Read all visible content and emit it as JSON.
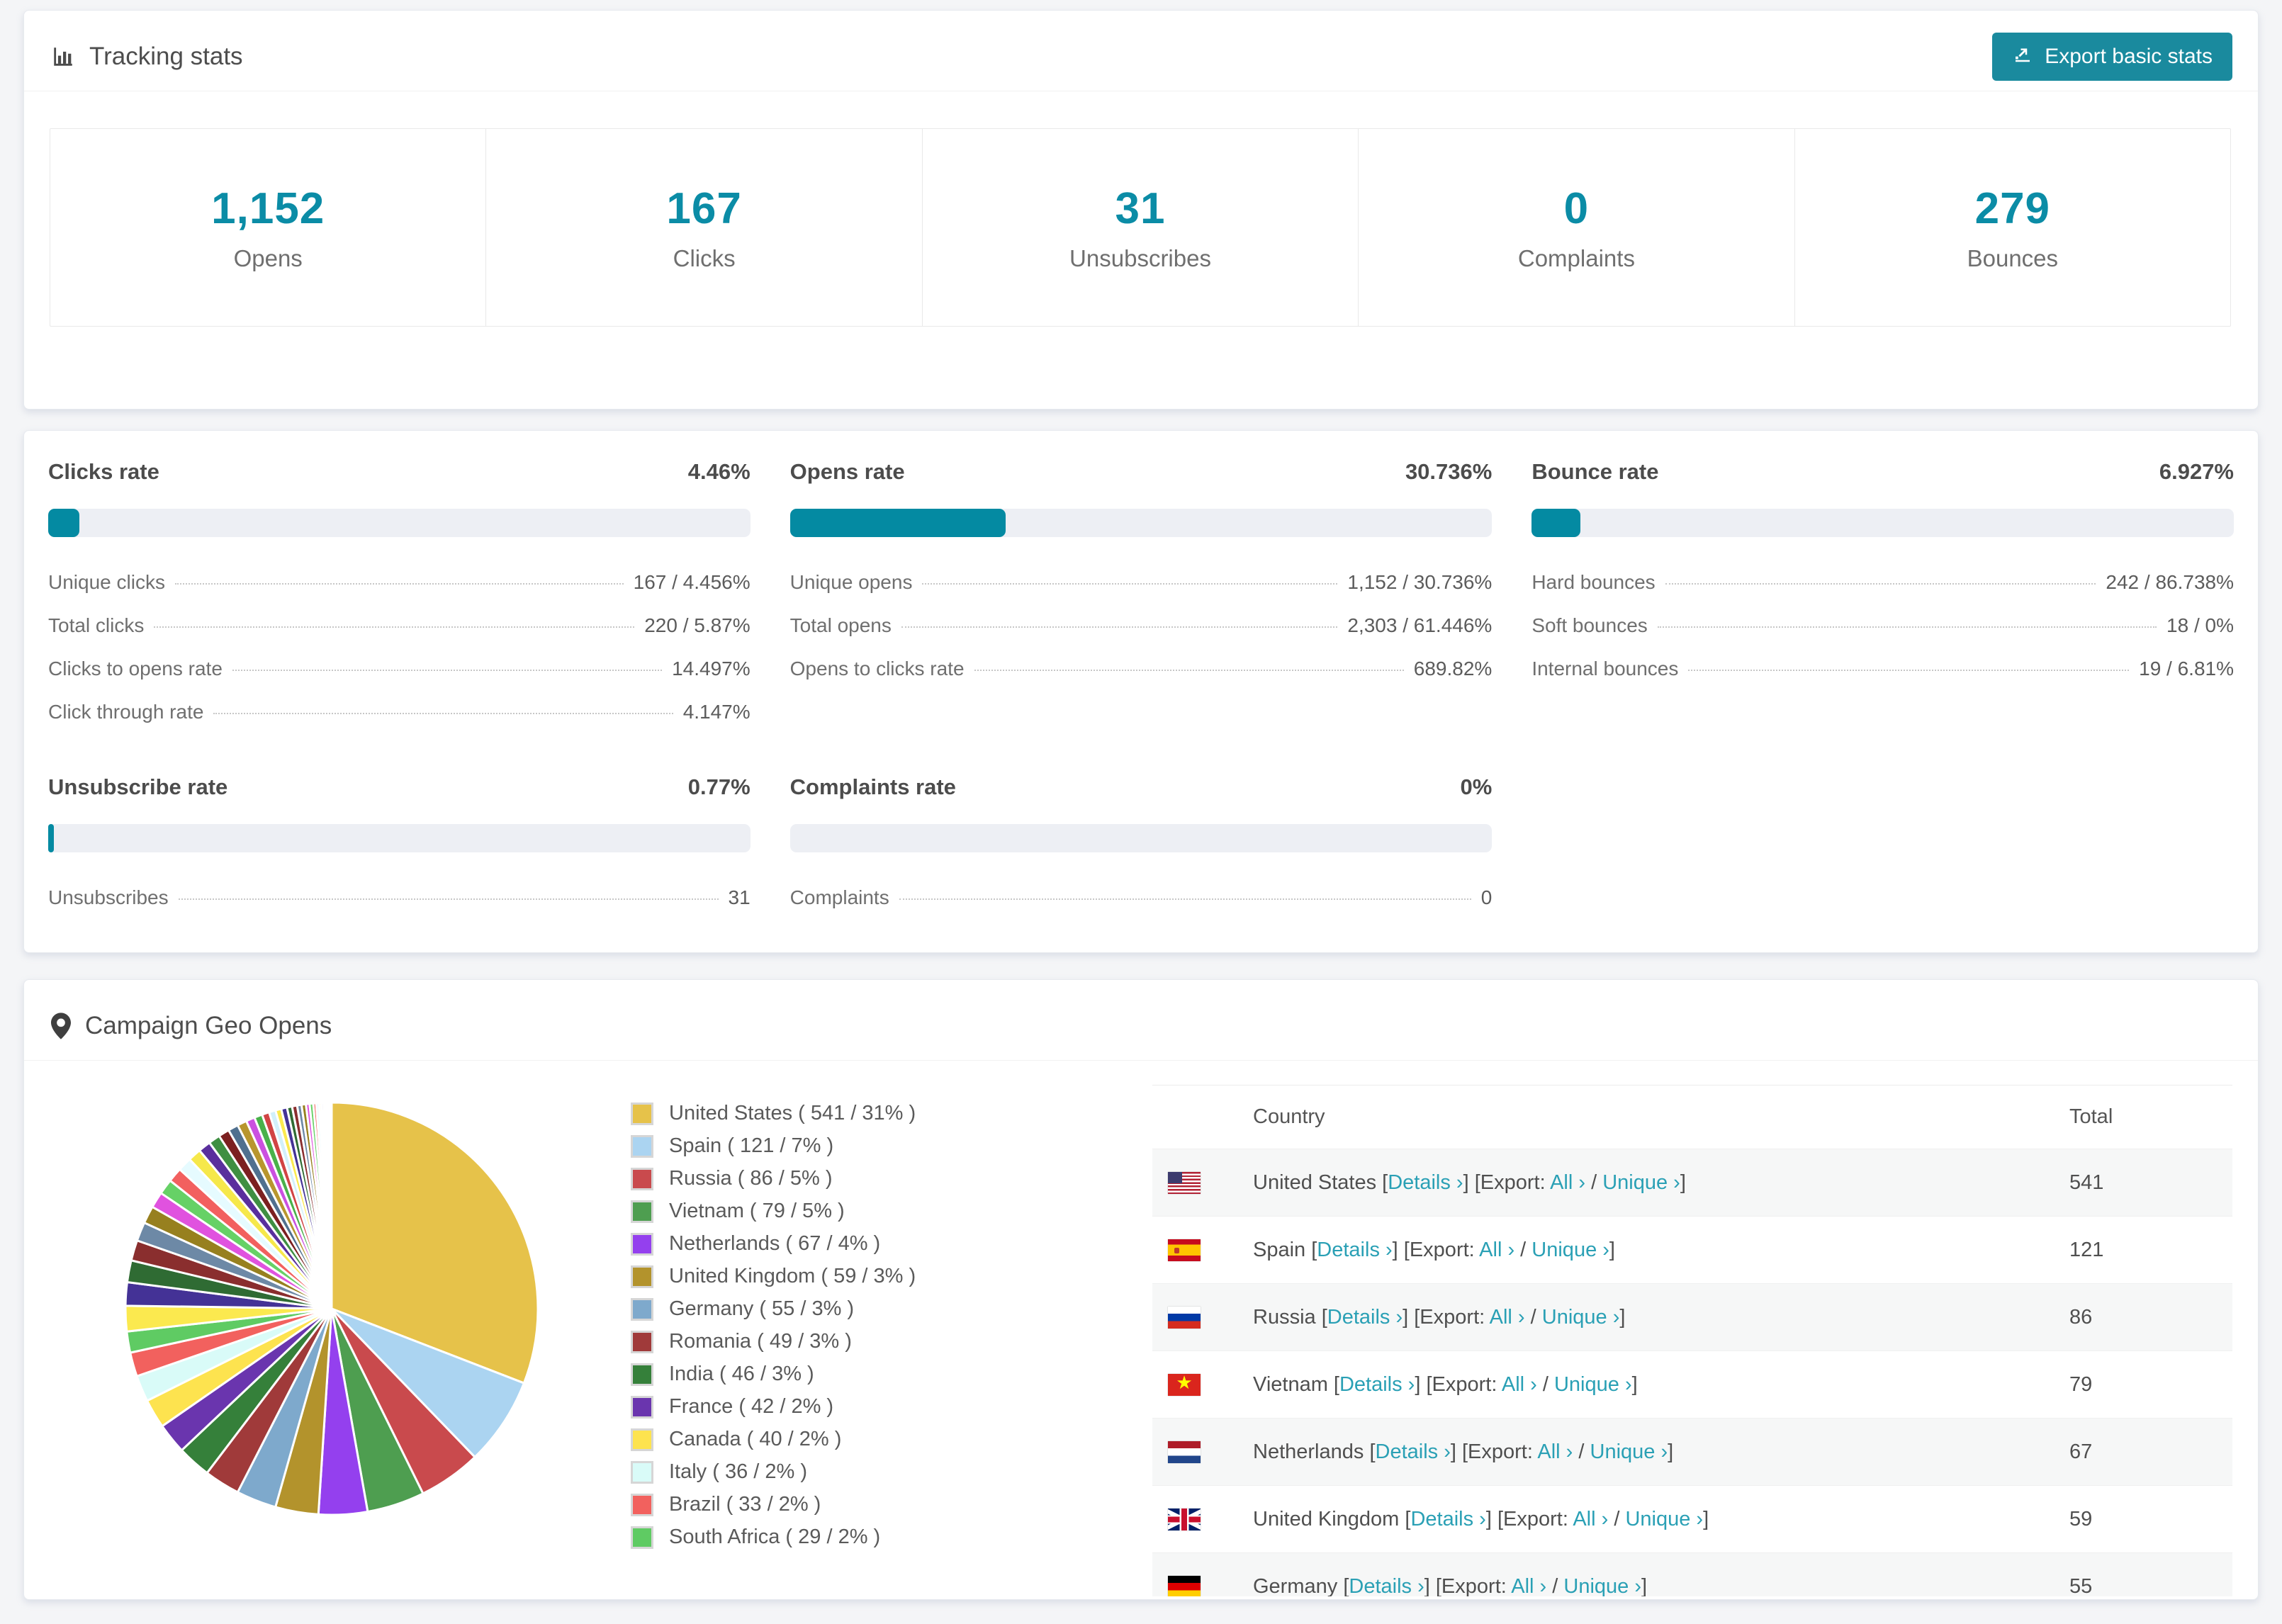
{
  "colors": {
    "accent": "#0b8ca6",
    "bar_fill": "#048aa2",
    "bar_track": "#edeff4",
    "button_bg": "#1a8a9e",
    "link": "#2aa0b5"
  },
  "tracking": {
    "title": "Tracking stats",
    "export_button": "Export basic stats",
    "stats": [
      {
        "value": "1,152",
        "label": "Opens"
      },
      {
        "value": "167",
        "label": "Clicks"
      },
      {
        "value": "31",
        "label": "Unsubscribes"
      },
      {
        "value": "0",
        "label": "Complaints"
      },
      {
        "value": "279",
        "label": "Bounces"
      }
    ]
  },
  "rates": [
    {
      "name": "Clicks rate",
      "value": "4.46%",
      "percent": 4.46,
      "rows": [
        {
          "label": "Unique clicks",
          "value": "167 / 4.456%"
        },
        {
          "label": "Total clicks",
          "value": "220 / 5.87%"
        },
        {
          "label": "Clicks to opens rate",
          "value": "14.497%"
        },
        {
          "label": "Click through rate",
          "value": "4.147%"
        }
      ]
    },
    {
      "name": "Opens rate",
      "value": "30.736%",
      "percent": 30.736,
      "rows": [
        {
          "label": "Unique opens",
          "value": "1,152 / 30.736%"
        },
        {
          "label": "Total opens",
          "value": "2,303 / 61.446%"
        },
        {
          "label": "Opens to clicks rate",
          "value": "689.82%"
        }
      ]
    },
    {
      "name": "Bounce rate",
      "value": "6.927%",
      "percent": 6.927,
      "rows": [
        {
          "label": "Hard bounces",
          "value": "242 / 86.738%"
        },
        {
          "label": "Soft bounces",
          "value": "18 / 0%"
        },
        {
          "label": "Internal bounces",
          "value": "19 / 6.81%"
        }
      ]
    },
    {
      "name": "Unsubscribe rate",
      "value": "0.77%",
      "percent": 0.77,
      "rows": [
        {
          "label": "Unsubscribes",
          "value": "31"
        }
      ]
    },
    {
      "name": "Complaints rate",
      "value": "0%",
      "percent": 0,
      "rows": [
        {
          "label": "Complaints",
          "value": "0"
        }
      ]
    }
  ],
  "geo": {
    "title": "Campaign Geo Opens",
    "table": {
      "headers": {
        "country": "Country",
        "total": "Total"
      },
      "labels": {
        "details": "Details ›",
        "export": "Export:",
        "all": "All ›",
        "unique": "Unique ›",
        "open_bracket": "[",
        "close_bracket": "]",
        "slash": "/"
      },
      "rows": [
        {
          "country": "United States",
          "total": "541",
          "flag": "us"
        },
        {
          "country": "Spain",
          "total": "121",
          "flag": "es"
        },
        {
          "country": "Russia",
          "total": "86",
          "flag": "ru"
        },
        {
          "country": "Vietnam",
          "total": "79",
          "flag": "vn"
        },
        {
          "country": "Netherlands",
          "total": "67",
          "flag": "nl"
        },
        {
          "country": "United Kingdom",
          "total": "59",
          "flag": "gb"
        },
        {
          "country": "Germany",
          "total": "55",
          "flag": "de"
        }
      ]
    }
  },
  "chart_data": {
    "type": "pie",
    "title": "Campaign Geo Opens",
    "legend_position": "right",
    "start_angle_deg": -90,
    "direction": "clockwise",
    "slices": [
      {
        "label": "United States",
        "value": 541,
        "pct": "31%",
        "color": "#e6c24a"
      },
      {
        "label": "Spain",
        "value": 121,
        "pct": "7%",
        "color": "#abd4f1"
      },
      {
        "label": "Russia",
        "value": 86,
        "pct": "5%",
        "color": "#c94a4d"
      },
      {
        "label": "Vietnam",
        "value": 79,
        "pct": "5%",
        "color": "#4e9e50"
      },
      {
        "label": "Netherlands",
        "value": 67,
        "pct": "4%",
        "color": "#9440ee"
      },
      {
        "label": "United Kingdom",
        "value": 59,
        "pct": "3%",
        "color": "#b3932c"
      },
      {
        "label": "Germany",
        "value": 55,
        "pct": "3%",
        "color": "#7ea9cc"
      },
      {
        "label": "Romania",
        "value": 49,
        "pct": "3%",
        "color": "#a03a3a"
      },
      {
        "label": "India",
        "value": 46,
        "pct": "3%",
        "color": "#35803a"
      },
      {
        "label": "France",
        "value": 42,
        "pct": "2%",
        "color": "#6a35ae"
      },
      {
        "label": "Canada",
        "value": 40,
        "pct": "2%",
        "color": "#fde34f"
      },
      {
        "label": "Italy",
        "value": 36,
        "pct": "2%",
        "color": "#d9fbf8"
      },
      {
        "label": "Brazil",
        "value": 33,
        "pct": "2%",
        "color": "#f2615e"
      },
      {
        "label": "South Africa",
        "value": 29,
        "pct": "2%",
        "color": "#5fcb63"
      }
    ],
    "other_slices": {
      "values": [
        35,
        32,
        30,
        28,
        26,
        24,
        22,
        21,
        20,
        19,
        18,
        17,
        16,
        15,
        14,
        13,
        12,
        11,
        10,
        9,
        8,
        8,
        7,
        7,
        6,
        6,
        5,
        5,
        4,
        4,
        3,
        3,
        2,
        2,
        2,
        1,
        1,
        1,
        1,
        1
      ],
      "palette": [
        "#fbe94f",
        "#443296",
        "#2f6b33",
        "#8a2e2e",
        "#6d89a6",
        "#97801f",
        "#e052df",
        "#66d166",
        "#f2605f",
        "#e6fbff",
        "#f6e84a",
        "#5a2f9d",
        "#3f8f42",
        "#7c2020",
        "#50708f",
        "#b8962e",
        "#cb50e0",
        "#49b14a",
        "#d14444",
        "#d2f0fb"
      ]
    }
  }
}
